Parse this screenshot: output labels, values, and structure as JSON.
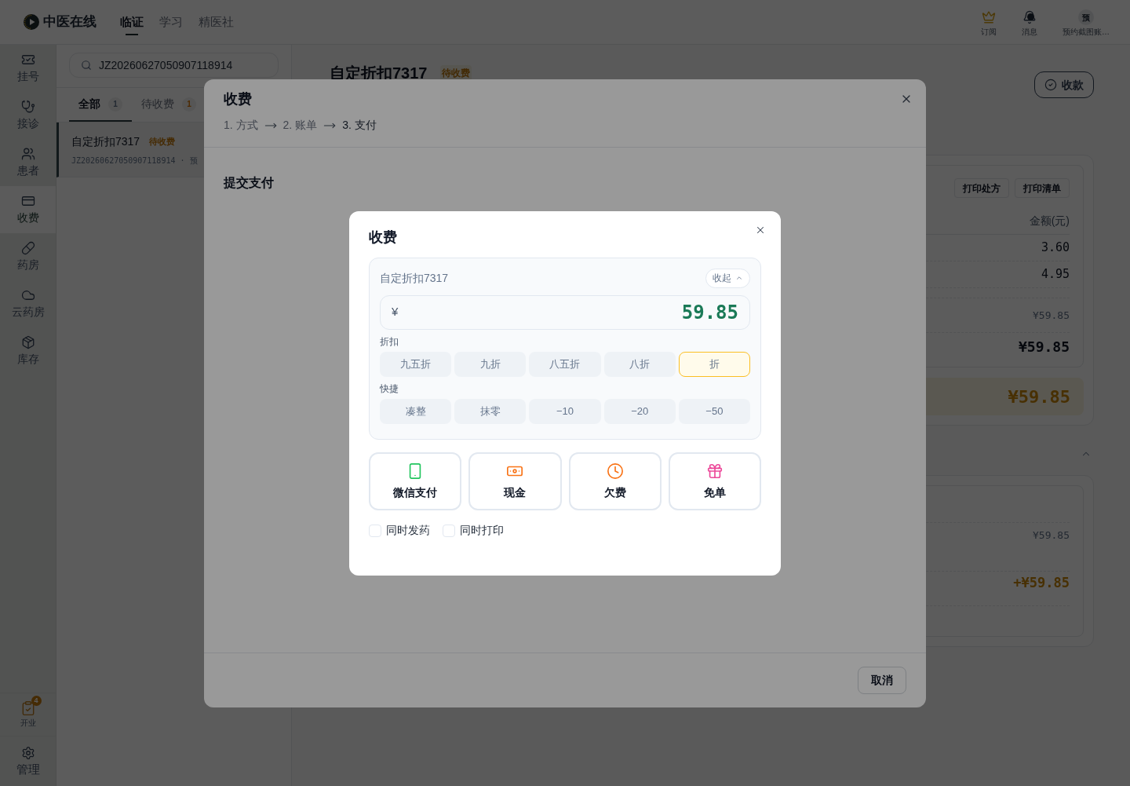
{
  "header": {
    "logo": "中医在线",
    "nav": [
      {
        "label": "临证",
        "selected": true
      },
      {
        "label": "学习",
        "selected": false
      },
      {
        "label": "精医社",
        "selected": false
      }
    ],
    "actions": [
      {
        "kind": "crown",
        "label": "订阅"
      },
      {
        "kind": "bell",
        "label": "消息"
      }
    ],
    "account": {
      "avatar": "预",
      "name": "预约截图账…"
    }
  },
  "sidebar": {
    "items": [
      {
        "kind": "ticket",
        "label": "挂号",
        "selected": false
      },
      {
        "kind": "stethoscope",
        "label": "接诊",
        "selected": false
      },
      {
        "kind": "users",
        "label": "患者",
        "selected": false
      },
      {
        "kind": "card",
        "label": "收费",
        "selected": true
      },
      {
        "kind": "pill",
        "label": "药房",
        "selected": false
      },
      {
        "kind": "cloud",
        "label": "云药房",
        "selected": false
      },
      {
        "kind": "package",
        "label": "库存",
        "selected": false
      }
    ],
    "footer": [
      {
        "kind": "clipboard",
        "label": "开业",
        "badge": "4"
      },
      {
        "kind": "gear",
        "label": "管理"
      }
    ]
  },
  "queue": {
    "search": {
      "value": "JZ20260627050907118914"
    },
    "tabs": [
      {
        "kind": "all",
        "label": "全部",
        "count": "1",
        "selected": true
      },
      {
        "kind": "pending",
        "label": "待收费",
        "count": "1",
        "selected": false
      }
    ],
    "items": [
      {
        "title": "自定折扣7317",
        "status": "待收费",
        "meta": "JZ20260627050907118914 · 预",
        "selected": true
      }
    ]
  },
  "detail": {
    "title": "自定折扣7317",
    "status": "待收费",
    "action": "收款",
    "bill": {
      "buttons": [
        "打印处方",
        "打印清单"
      ],
      "column": "金额(元)",
      "rows": [
        "3.60",
        "4.95"
      ],
      "subtotal": "¥59.85",
      "total": "¥59.85",
      "payable": "¥59.85"
    },
    "payments": {
      "expanded": true,
      "rows": [
        {
          "kind": "amount",
          "value": "¥59.85"
        },
        {
          "kind": "charge",
          "value": "+¥59.85"
        }
      ]
    }
  },
  "steps_dialog": {
    "title": "收费",
    "steps": [
      {
        "label": "1. 方式",
        "selected": false
      },
      {
        "label": "2. 账单",
        "selected": false
      },
      {
        "label": "3. 支付",
        "selected": true
      }
    ],
    "section": "提交支付",
    "cancel": "取消"
  },
  "charge_dialog": {
    "title": "收费",
    "patient": "自定折扣7317",
    "collapse": {
      "label": "收起",
      "expanded": true
    },
    "amount": {
      "currency": "¥",
      "value": "59.85"
    },
    "discount": {
      "label": "折扣",
      "options": [
        {
          "label": "九五折",
          "selected": false
        },
        {
          "label": "九折",
          "selected": false
        },
        {
          "label": "八五折",
          "selected": false
        },
        {
          "label": "八折",
          "selected": false
        },
        {
          "label": "折",
          "selected": true
        }
      ]
    },
    "quick": {
      "label": "快捷",
      "options": [
        "凑整",
        "抹零",
        "−10",
        "−20",
        "−50"
      ]
    },
    "methods": [
      {
        "kind": "phone",
        "label": "微信支付"
      },
      {
        "kind": "cash",
        "label": "现金"
      },
      {
        "kind": "clock",
        "label": "欠费"
      },
      {
        "kind": "gift",
        "label": "免单"
      }
    ],
    "options": [
      {
        "label": "同时发药",
        "checked": false
      },
      {
        "label": "同时打印",
        "checked": false
      }
    ]
  }
}
